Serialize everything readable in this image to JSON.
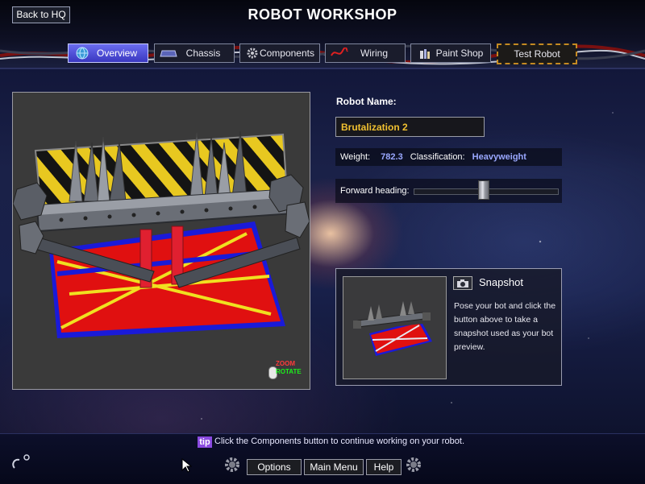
{
  "header": {
    "back_label": "Back to HQ",
    "title": "ROBOT WORKSHOP",
    "tabs": [
      {
        "label": "Overview",
        "icon": "globe-icon",
        "active": true
      },
      {
        "label": "Chassis",
        "icon": "chassis-icon",
        "active": false
      },
      {
        "label": "Components",
        "icon": "gear-icon",
        "active": false
      },
      {
        "label": "Wiring",
        "icon": "wire-icon",
        "active": false
      },
      {
        "label": "Paint Shop",
        "icon": "paint-icon",
        "active": false
      },
      {
        "label": "Test Robot",
        "icon": "",
        "active": false
      }
    ]
  },
  "viewport": {
    "zoom_label": "ZOOM",
    "rotate_label": "ROTATE"
  },
  "robot": {
    "name_label": "Robot Name:",
    "name_value": "Brutalization 2",
    "weight_label": "Weight:",
    "weight_value": "782.3",
    "class_label": "Classification:",
    "class_value": "Heavyweight",
    "heading_label": "Forward heading:",
    "heading_fraction": 0.49
  },
  "snapshot": {
    "title": "Snapshot",
    "description": "Pose your bot and click the button above to take a snapshot used as your bot preview."
  },
  "footer": {
    "tip_tag": "tip",
    "tip_text": "Click the Components button to continue working on your robot.",
    "options_label": "Options",
    "main_menu_label": "Main Menu",
    "help_label": "Help"
  },
  "colors": {
    "accent": "#4a48d8",
    "name_text": "#f0c030",
    "stat_value": "#9aa8ff",
    "tip_tag": "#8a4ae0"
  }
}
